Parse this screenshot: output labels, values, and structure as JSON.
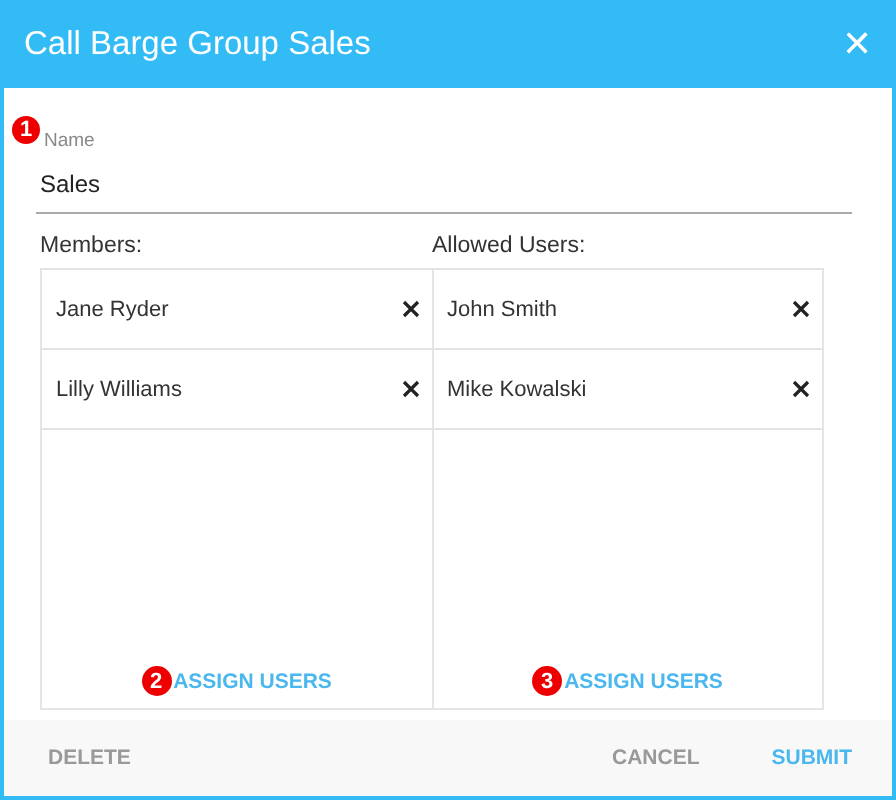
{
  "dialog": {
    "title": "Call Barge Group Sales",
    "close": "✕"
  },
  "name_field": {
    "marker": "1",
    "label": "Name",
    "value": "Sales"
  },
  "lists": [
    {
      "heading": "Members:",
      "items": [
        {
          "name": "Jane Ryder"
        },
        {
          "name": "Lilly Williams"
        }
      ],
      "marker": "2",
      "action": "ASSIGN USERS"
    },
    {
      "heading": "Allowed Users:",
      "items": [
        {
          "name": "John Smith"
        },
        {
          "name": "Mike Kowalski"
        }
      ],
      "marker": "3",
      "action": "ASSIGN USERS"
    }
  ],
  "footer": {
    "left": [
      "DELETE"
    ],
    "right": [
      {
        "label": "CANCEL",
        "primary": false
      },
      {
        "label": "SUBMIT",
        "primary": true
      }
    ]
  }
}
